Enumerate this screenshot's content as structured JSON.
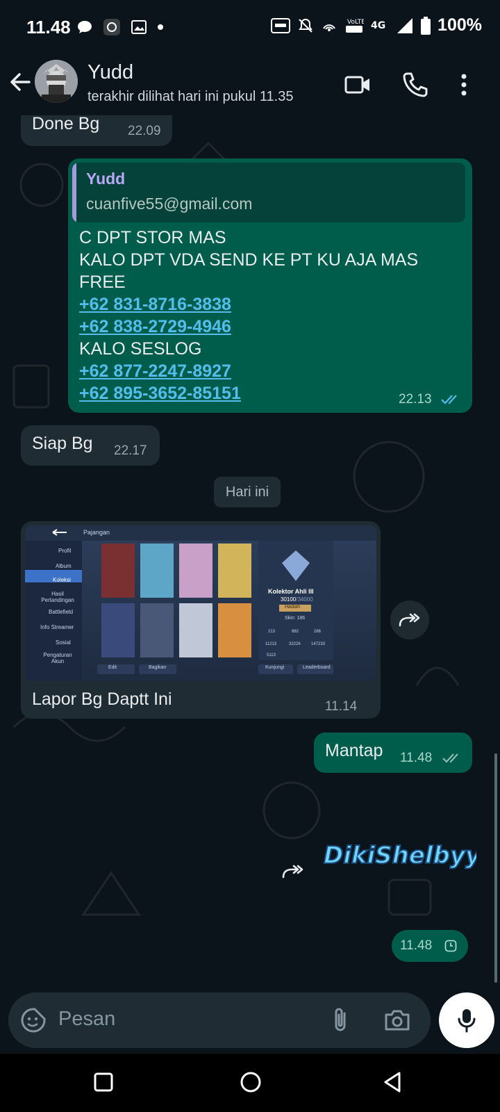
{
  "status_bar": {
    "time": "11.48",
    "battery": "100%"
  },
  "header": {
    "contact_name": "Yudd",
    "last_seen": "terakhir dilihat hari ini pukul 11.35"
  },
  "messages": {
    "m1": {
      "text": "Done Bg",
      "time": "22.09"
    },
    "m2": {
      "quote_name": "Yudd",
      "quote_text": "cuanfive55@gmail.com",
      "line1": "C DPT STOR MAS",
      "line2": "KALO DPT VDA SEND KE PT KU AJA MAS",
      "line3": "FREE",
      "phone1": "+62 831-8716-3838",
      "phone2": "+62 838-2729-4946",
      "line4": "KALO SESLOG",
      "phone3": "+62 877-2247-8927",
      "phone4": "+62 895-3652-85151",
      "time": "22.13"
    },
    "m3": {
      "text": "Siap Bg",
      "time": "22.17"
    },
    "date_chip": "Hari ini",
    "m4": {
      "caption": "Lapor Bg Daptt Ini",
      "time": "11.14",
      "image": {
        "header": "Pajangan",
        "menu": [
          "Profil",
          "Album",
          "Koleksi",
          "Hasil Pertandingan",
          "Battlefield",
          "Info Streamer",
          "Sosial",
          "Pengaturan Akun"
        ],
        "rank_title": "Kolektor Ahli III",
        "rank_points": "30100",
        "rank_points_max": "/34000",
        "rank_button": "Hadiah",
        "skin_count": "Skin: 186",
        "stats": [
          "213",
          "882",
          "286",
          "11213",
          "32226",
          "147233",
          "5113"
        ],
        "buttons": [
          "Edit",
          "Bagikan",
          "Kunjungi",
          "Leaderboard"
        ]
      }
    },
    "m5": {
      "text": "Mantap",
      "time": "11.48"
    },
    "m6": {
      "sticker_text": "DikiShelbyy"
    },
    "m7": {
      "time": "11.48"
    }
  },
  "input": {
    "placeholder": "Pesan"
  },
  "colors": {
    "background": "#0b141a",
    "incoming_bubble": "#202c33",
    "outgoing_bubble": "#005c4b",
    "link": "#53bdeb",
    "read_ticks": "#53bdeb"
  }
}
